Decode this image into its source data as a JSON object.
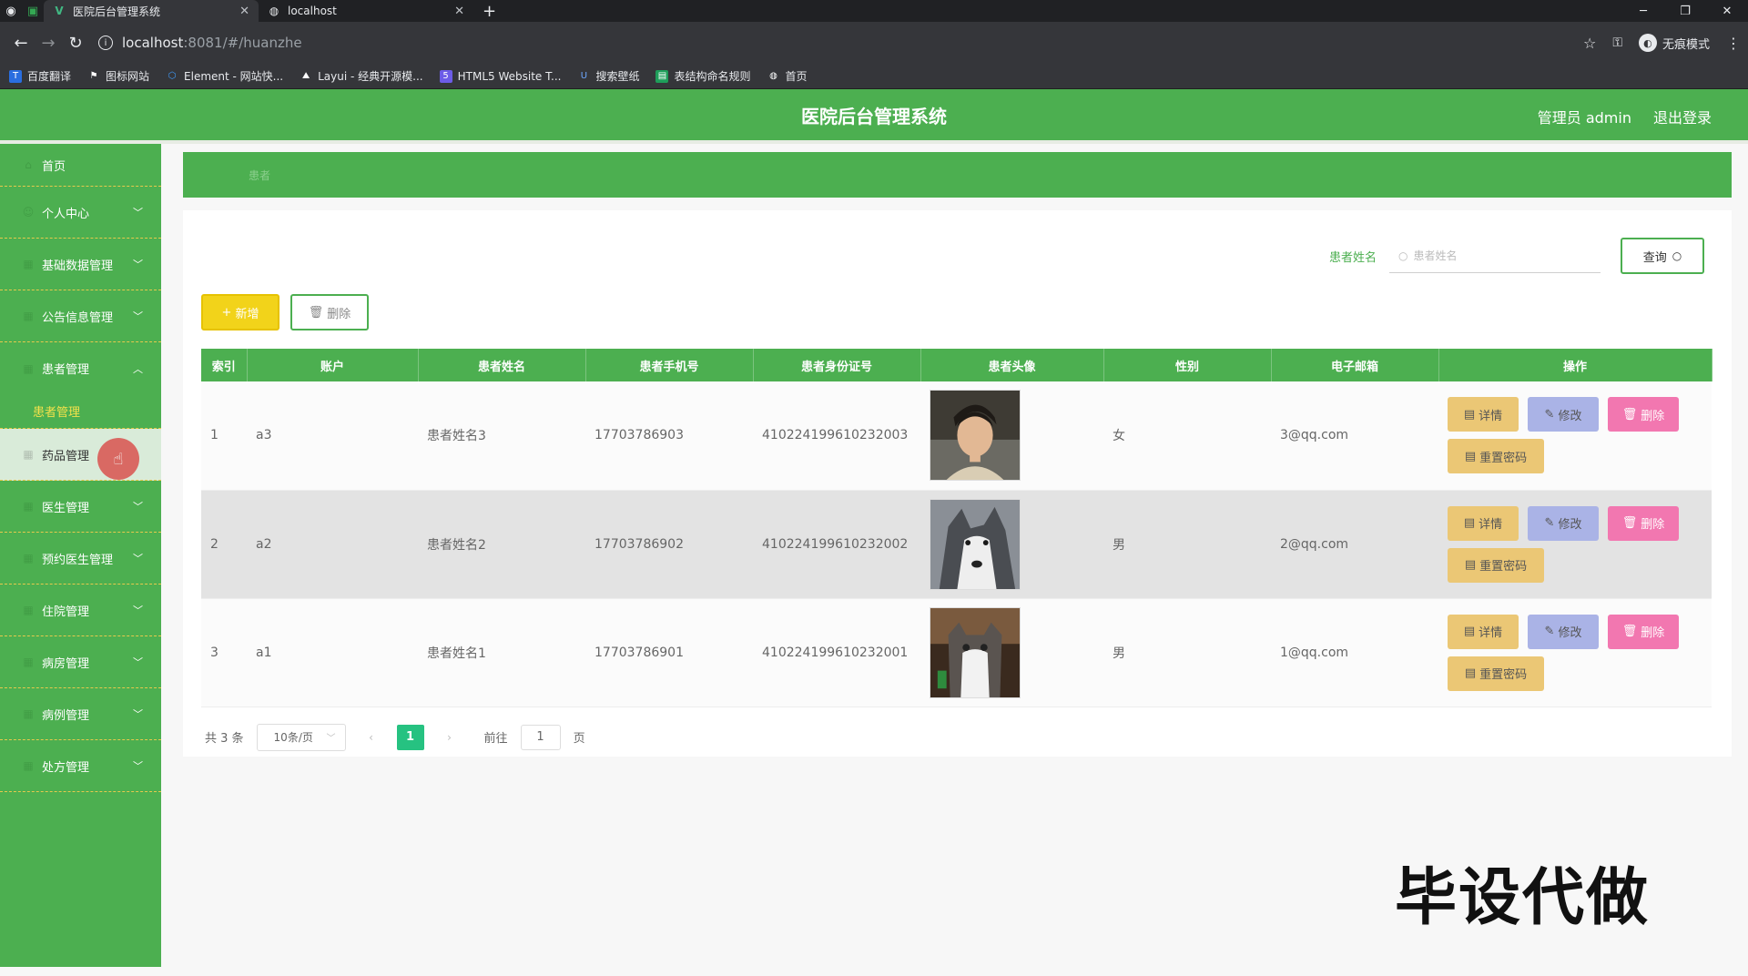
{
  "browser": {
    "tabs": [
      {
        "title": "医院后台管理系统",
        "active": true
      },
      {
        "title": "localhost",
        "active": false
      }
    ],
    "url_host": "localhost",
    "url_path": ":8081/#/huanzhe",
    "profile_label": "无痕模式",
    "bookmarks": [
      "百度翻译",
      "图标网站",
      "Element - 网站快...",
      "Layui - 经典开源模...",
      "HTML5 Website T...",
      "搜索壁纸",
      "表结构命名规则",
      "首页"
    ]
  },
  "header": {
    "title": "医院后台管理系统",
    "user_label": "管理员 admin",
    "logout_label": "退出登录"
  },
  "sidebar": {
    "items": [
      {
        "label": "首页",
        "arrow": ""
      },
      {
        "label": "个人中心",
        "arrow": "﹀"
      },
      {
        "label": "基础数据管理",
        "arrow": "﹀"
      },
      {
        "label": "公告信息管理",
        "arrow": "﹀"
      },
      {
        "label": "患者管理",
        "arrow": "︿"
      },
      {
        "label": "药品管理",
        "arrow": ""
      },
      {
        "label": "医生管理",
        "arrow": "﹀"
      },
      {
        "label": "预约医生管理",
        "arrow": "﹀"
      },
      {
        "label": "住院管理",
        "arrow": "﹀"
      },
      {
        "label": "病房管理",
        "arrow": "﹀"
      },
      {
        "label": "病例管理",
        "arrow": "﹀"
      },
      {
        "label": "处方管理",
        "arrow": "﹀"
      }
    ],
    "submenu_label": "患者管理"
  },
  "breadcrumb": {
    "label": "患者"
  },
  "search": {
    "label": "患者姓名",
    "placeholder": "患者姓名",
    "button_label": "查询"
  },
  "actions": {
    "add_label": "新增",
    "delete_label": "删除"
  },
  "table": {
    "headers": [
      "索引",
      "账户",
      "患者姓名",
      "患者手机号",
      "患者身份证号",
      "患者头像",
      "性别",
      "电子邮箱",
      "操作"
    ],
    "rows": [
      {
        "index": "1",
        "account": "a3",
        "name": "患者姓名3",
        "phone": "17703786903",
        "id_card": "410224199610232003",
        "avatar": "person",
        "gender": "女",
        "email": "3@qq.com"
      },
      {
        "index": "2",
        "account": "a2",
        "name": "患者姓名2",
        "phone": "17703786902",
        "id_card": "410224199610232002",
        "avatar": "husky",
        "gender": "男",
        "email": "2@qq.com"
      },
      {
        "index": "3",
        "account": "a1",
        "name": "患者姓名1",
        "phone": "17703786901",
        "id_card": "410224199610232001",
        "avatar": "cat",
        "gender": "男",
        "email": "1@qq.com"
      }
    ],
    "op_labels": {
      "detail": "详情",
      "edit": "修改",
      "remove": "删除",
      "reset": "重置密码"
    }
  },
  "pagination": {
    "total_label": "共 3 条",
    "page_size_label": "10条/页",
    "current_page": "1",
    "goto_label": "前往",
    "goto_value": "1",
    "page_suffix": "页"
  },
  "watermark": "毕设代做",
  "colors": {
    "primary": "#4caf50",
    "add": "#f2d31a",
    "detail": "#ebc775",
    "edit": "#aab3e6",
    "remove": "#f277b0",
    "pager_active": "#26c281"
  }
}
